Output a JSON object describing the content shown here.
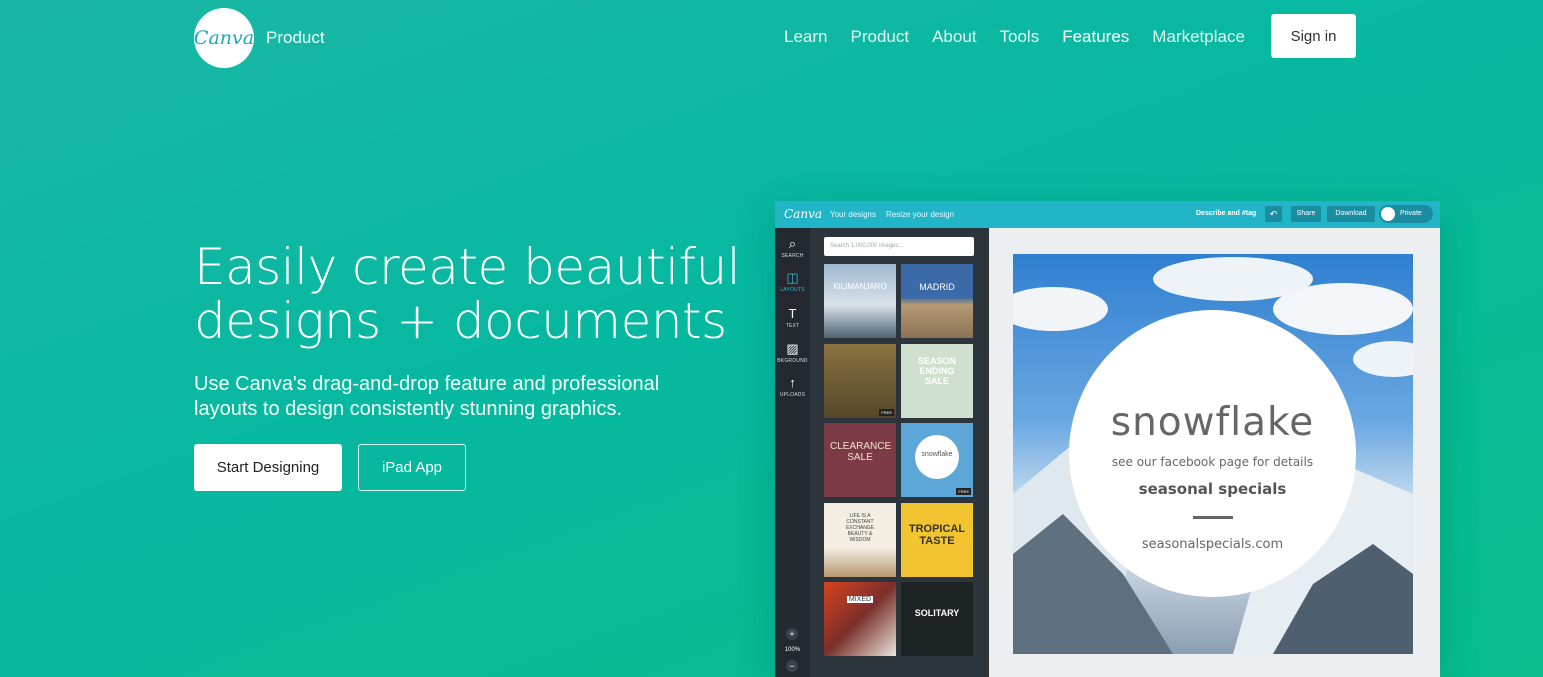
{
  "header": {
    "logo_text": "Canva",
    "brand_label": "Product",
    "nav": [
      {
        "label": "Learn"
      },
      {
        "label": "Product"
      },
      {
        "label": "About"
      },
      {
        "label": "Tools"
      },
      {
        "label": "Features"
      },
      {
        "label": "Marketplace"
      }
    ],
    "active_nav": "Features",
    "signin_label": "Sign in"
  },
  "hero": {
    "title": "Easily create beautiful designs + documents",
    "subtitle": "Use Canva's drag-and-drop feature and professional layouts to design consistently stunning graphics.",
    "start_label": "Start Designing",
    "ipad_label": "iPad App"
  },
  "editor": {
    "logo_text": "Canva",
    "top_links": [
      "Your designs",
      "Resize your design"
    ],
    "describe_label": "Describe and #tag",
    "share_label": "Share",
    "download_label": "Download",
    "private_label": "Private",
    "tools": [
      {
        "icon": "search-icon",
        "label": "SEARCH"
      },
      {
        "icon": "layouts-icon",
        "label": "LAYOUTS"
      },
      {
        "icon": "text-icon",
        "label": "TEXT"
      },
      {
        "icon": "background-icon",
        "label": "BKGROUND"
      },
      {
        "icon": "upload-icon",
        "label": "UPLOADS"
      }
    ],
    "zoom_level": "100%",
    "search_placeholder": "Search 1,000,000 images...",
    "thumbnails": [
      {
        "text": "KILIMANJARO",
        "free": ""
      },
      {
        "text": "MADRID",
        "free": ""
      },
      {
        "text": "",
        "free": "FREE"
      },
      {
        "text": "SEASON ENDING SALE",
        "free": ""
      },
      {
        "text": "CLEARANCE SALE",
        "free": ""
      },
      {
        "text": "snowflake",
        "free": "FREE"
      },
      {
        "text": "LIFE IS A CONSTANT EXCHANGE BEAUTY & WISDOM",
        "free": ""
      },
      {
        "text": "TROPICAL TASTE",
        "free": ""
      },
      {
        "text": "MIXED",
        "free": ""
      },
      {
        "text": "SOLITARY",
        "free": ""
      }
    ],
    "design": {
      "title": "snowflake",
      "subtitle": "see our facebook page for details",
      "specials": "seasonal specials",
      "url": "seasonalspecials.com"
    }
  }
}
